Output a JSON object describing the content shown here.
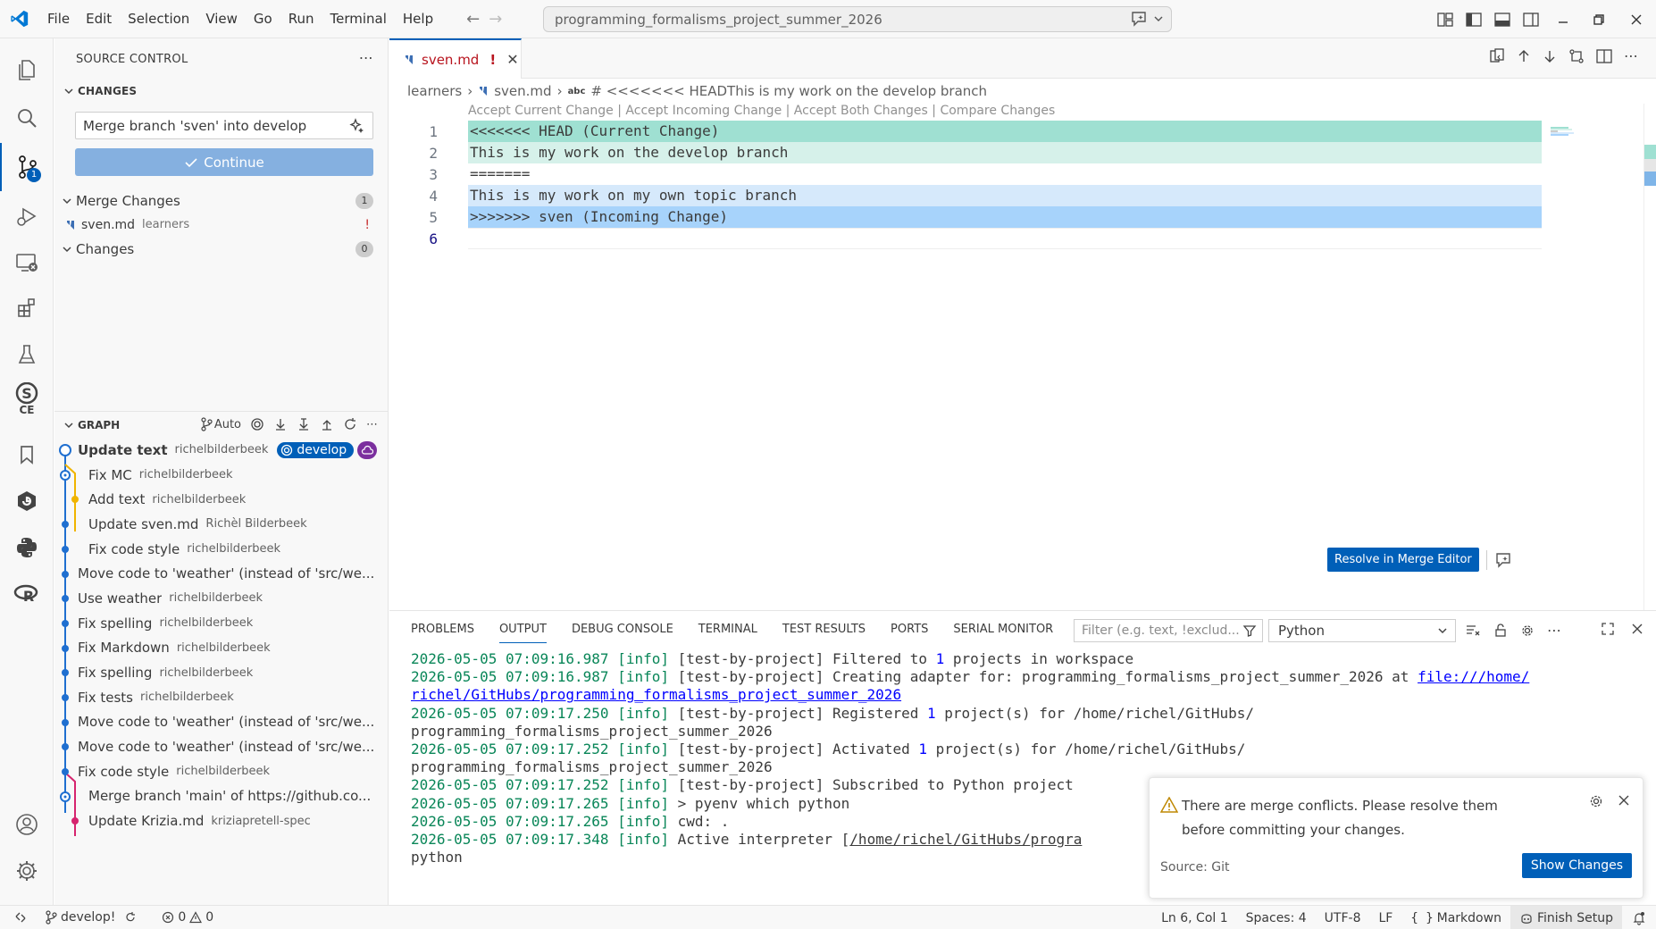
{
  "menu": [
    "File",
    "Edit",
    "Selection",
    "View",
    "Go",
    "Run",
    "Terminal",
    "Help"
  ],
  "command_center": "programming_formalisms_project_summer_2026",
  "activity": {
    "scm_badge": "1",
    "ce_label": "CE"
  },
  "sidebar": {
    "title": "SOURCE CONTROL",
    "changes_header": "CHANGES",
    "commit_message": "Merge branch 'sven' into develop",
    "continue_label": "Continue",
    "merge_changes": {
      "label": "Merge Changes",
      "count": "1"
    },
    "merge_file": {
      "name": "sven.md",
      "folder": "learners",
      "status": "!"
    },
    "changes": {
      "label": "Changes",
      "count": "0"
    }
  },
  "graph": {
    "title": "GRAPH",
    "auto_label": "Auto",
    "branch": "develop",
    "commits": [
      {
        "msg": "Update text",
        "author": "richelbilderbeek"
      },
      {
        "msg": "Fix MC",
        "author": "richelbilderbeek"
      },
      {
        "msg": "Add text",
        "author": "richelbilderbeek"
      },
      {
        "msg": "Update sven.md",
        "author": "Richèl Bilderbeek"
      },
      {
        "msg": "Fix code style",
        "author": "richelbilderbeek"
      },
      {
        "msg": "Move code to 'weather' (instead of 'src/we...",
        "author": ""
      },
      {
        "msg": "Use weather",
        "author": "richelbilderbeek"
      },
      {
        "msg": "Fix spelling",
        "author": "richelbilderbeek"
      },
      {
        "msg": "Fix Markdown",
        "author": "richelbilderbeek"
      },
      {
        "msg": "Fix spelling",
        "author": "richelbilderbeek"
      },
      {
        "msg": "Fix tests",
        "author": "richelbilderbeek"
      },
      {
        "msg": "Move code to 'weather' (instead of 'src/we...",
        "author": ""
      },
      {
        "msg": "Move code to 'weather' (instead of 'src/we...",
        "author": ""
      },
      {
        "msg": "Fix code style",
        "author": "richelbilderbeek"
      },
      {
        "msg": "Merge branch 'main' of https://github.co...",
        "author": ""
      },
      {
        "msg": "Update Krizia.md",
        "author": "kriziapretell-spec"
      }
    ]
  },
  "editor": {
    "tab": {
      "name": "sven.md",
      "status": "!"
    },
    "breadcrumb": {
      "folder": "learners",
      "file": "sven.md",
      "abc": "abc",
      "symbol": "# <<<<<<< HEADThis is my work on the develop branch"
    },
    "codelens": "Accept Current Change | Accept Incoming Change | Accept Both Changes | Compare Changes",
    "lines": [
      {
        "n": "1",
        "text": "<<<<<<< HEAD (Current Change)"
      },
      {
        "n": "2",
        "text": "This is my work on the develop branch"
      },
      {
        "n": "3",
        "text": "======="
      },
      {
        "n": "4",
        "text": "This is my work on my own topic branch"
      },
      {
        "n": "5",
        "text": ">>>>>>> sven (Incoming Change)"
      },
      {
        "n": "6",
        "text": ""
      }
    ],
    "resolve_label": "Resolve in Merge Editor"
  },
  "panel": {
    "tabs": [
      "PROBLEMS",
      "OUTPUT",
      "DEBUG CONSOLE",
      "TERMINAL",
      "TEST RESULTS",
      "PORTS",
      "SERIAL MONITOR"
    ],
    "filter_placeholder": "Filter (e.g. text, !exclud...",
    "channel": "Python",
    "output": {
      "l1_ts": "2026-05-05 07:09:16.987",
      "l1_lvl": "[info]",
      "l1_a": "[test-by-project] Filtered to ",
      "l1_num": "1",
      "l1_b": " projects in workspace",
      "l2_ts": "2026-05-05 07:09:16.987",
      "l2_lvl": "[info]",
      "l2_a": "[test-by-project] Creating adapter for: programming_formalisms_project_summer_2026 at ",
      "l2_link": "file:///home/",
      "l3_link": "richel/GitHubs/programming_formalisms_project_summer_2026",
      "l4_ts": "2026-05-05 07:09:17.250",
      "l4_lvl": "[info]",
      "l4_a": "[test-by-project] Registered ",
      "l4_num": "1",
      "l4_b": " project(s) for /home/richel/GitHubs/",
      "l5": "programming_formalisms_project_summer_2026",
      "l6_ts": "2026-05-05 07:09:17.252",
      "l6_lvl": "[info]",
      "l6_a": "[test-by-project] Activated ",
      "l6_num": "1",
      "l6_b": " project(s) for /home/richel/GitHubs/",
      "l7": "programming_formalisms_project_summer_2026",
      "l8_ts": "2026-05-05 07:09:17.252",
      "l8_lvl": "[info]",
      "l8_a": "[test-by-project] Subscribed to Python project",
      "l9_ts": "2026-05-05 07:09:17.265",
      "l9_lvl": "[info]",
      "l9_a": "> pyenv which python",
      "l10_ts": "2026-05-05 07:09:17.265",
      "l10_lvl": "[info]",
      "l10_a": "cwd: .",
      "l11_ts": "2026-05-05 07:09:17.348",
      "l11_lvl": "[info]",
      "l11_a": "Active interpreter [",
      "l11_u": "/home/richel/GitHubs/progra",
      "l12": "python"
    }
  },
  "notification": {
    "message": "There are merge conflicts. Please resolve them before committing your changes.",
    "source": "Source: Git",
    "button": "Show Changes"
  },
  "status": {
    "branch": "develop!",
    "errors": "0",
    "warnings": "0",
    "position": "Ln 6, Col 1",
    "spaces": "Spaces: 4",
    "encoding": "UTF-8",
    "eol": "LF",
    "language": "Markdown",
    "finish": "Finish Setup"
  },
  "colors": {
    "accent": "#005fb8",
    "current_change_header": "#9fe0d2",
    "current_change": "#d6f1ea",
    "incoming_change": "#d6e9fb",
    "incoming_change_header": "#a7d3fb",
    "graph_blue": "#1f6fd0",
    "graph_yellow": "#f0b400",
    "graph_pink": "#d6246e"
  }
}
